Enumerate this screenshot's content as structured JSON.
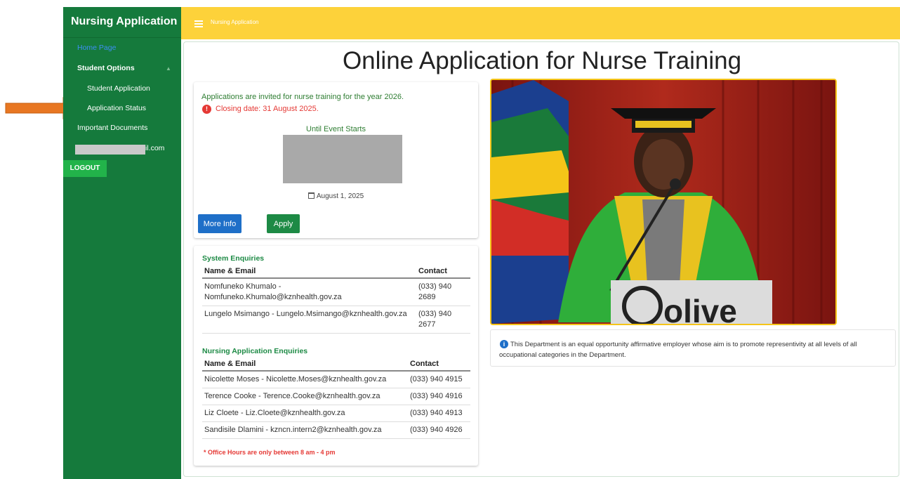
{
  "app": {
    "sidebar_title": "Nursing Application",
    "header_title": "Nursing Application"
  },
  "sidebar": {
    "home": "Home Page",
    "student_options": "Student Options",
    "student_application": "Student Application",
    "application_status": "Application Status",
    "important_documents": "Important Documents",
    "email_visible": "il.com",
    "logout": "LOGOUT"
  },
  "main": {
    "title": "Online Application for Nurse Training",
    "invite": "Applications are invited for nurse training for the year 2026.",
    "closing": "Closing date: 31 August 2025.",
    "until_event": "Until Event Starts",
    "event_date": "August 1, 2025",
    "more_info": "More Info",
    "apply": "Apply"
  },
  "system_enquiries": {
    "title": "System Enquiries",
    "headers": [
      "Name & Email",
      "Contact"
    ],
    "rows": [
      {
        "name": "Nomfuneko Khumalo - Nomfuneko.Khumalo@kznhealth.gov.za",
        "contact": "(033) 940 2689"
      },
      {
        "name": "Lungelo Msimango - Lungelo.Msimango@kznhealth.gov.za",
        "contact": "(033) 940 2677"
      }
    ]
  },
  "nursing_enquiries": {
    "title": "Nursing Application Enquiries",
    "headers": [
      "Name & Email",
      "Contact"
    ],
    "rows": [
      {
        "name": "Nicolette Moses - Nicolette.Moses@kznhealth.gov.za",
        "contact": "(033) 940 4915"
      },
      {
        "name": "Terence Cooke - Terence.Cooke@kznhealth.gov.za",
        "contact": "(033) 940 4916"
      },
      {
        "name": "Liz Cloete - Liz.Cloete@kznhealth.gov.za",
        "contact": "(033) 940 4913"
      },
      {
        "name": "Sandisile Dlamini - kzncn.intern2@kznhealth.gov.za",
        "contact": "(033) 940 4926"
      }
    ]
  },
  "office_hours": "* Office Hours are only between 8 am - 4 pm",
  "notice": "This Department is an equal opportunity affirmative employer whose aim is to promote representivity at all levels of all occupational categories in the Department.",
  "photo": {
    "podium_text": "olive"
  },
  "colors": {
    "sidebar": "#157a3c",
    "header": "#fdd23a",
    "accent_green": "#1d8a45",
    "primary_blue": "#1e6fc8",
    "alert_red": "#e53935",
    "annotation_arrow": "#e87722"
  }
}
